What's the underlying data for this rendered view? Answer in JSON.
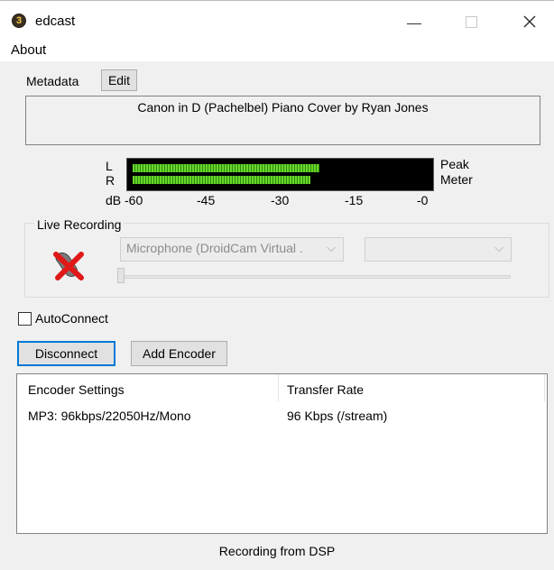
{
  "window": {
    "title": "edcast",
    "icon_glyph": "3"
  },
  "menu": {
    "about": "About"
  },
  "metadata": {
    "label": "Metadata",
    "edit_button": "Edit",
    "now_playing": "Canon in D (Pachelbel) Piano Cover by Ryan Jones"
  },
  "meter": {
    "channel_left": "L",
    "channel_right": "R",
    "peak_label": "Peak",
    "meter_label": "Meter",
    "scale": [
      "dB -60",
      "-45",
      "-30",
      "-15",
      "-0"
    ],
    "level_left": 0.63,
    "level_right": 0.6,
    "bar_color": "#6ad629"
  },
  "live_recording": {
    "label": "Live Recording",
    "device_select": "Microphone (DroidCam Virtual .",
    "channel_select": ""
  },
  "options": {
    "autoconnect_label": "AutoConnect",
    "autoconnect_checked": false
  },
  "buttons": {
    "disconnect": "Disconnect",
    "add_encoder": "Add Encoder"
  },
  "encoders": {
    "columns": [
      "Encoder Settings",
      "Transfer Rate"
    ],
    "rows": [
      {
        "settings": "MP3: 96kbps/22050Hz/Mono",
        "rate": "96 Kbps (/stream)"
      }
    ]
  },
  "status": {
    "text": "Recording from DSP"
  }
}
